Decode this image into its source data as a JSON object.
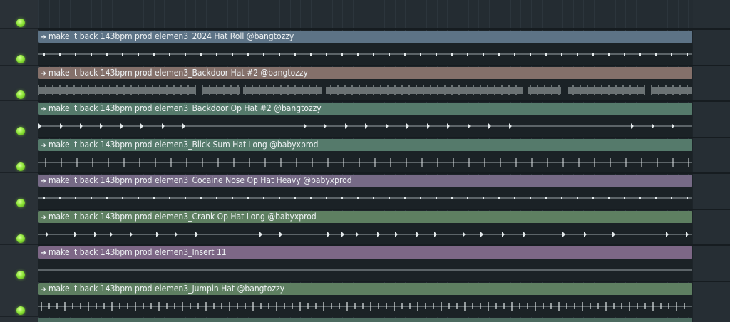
{
  "tracks": [
    {
      "label": "make it back 143bpm prod elemen3_2024 Hat Roll @bangtozzy",
      "color": "#5d7386",
      "wave": "sparse-diamonds"
    },
    {
      "label": "make it back 143bpm prod elemen3_Backdoor Hat #2 @bangtozzy",
      "color": "#84706a",
      "wave": "dense"
    },
    {
      "label": "make it back 143bpm prod elemen3_Backdoor Op Hat #2 @bangtozzy",
      "color": "#557a6b",
      "wave": "arrows-a"
    },
    {
      "label": "make it back 143bpm prod elemen3_Blick Sum Hat Long @babyxprod",
      "color": "#557a6b",
      "wave": "ticks"
    },
    {
      "label": "make it back 143bpm prod elemen3_Cocaine Nose Op Hat Heavy @babyxprod",
      "color": "#766a86",
      "wave": "sparse-diamonds"
    },
    {
      "label": "make it back 143bpm prod elemen3_Crank Op Hat Long @babyxprod",
      "color": "#5e7f61",
      "wave": "arrows-b"
    },
    {
      "label": "make it back 143bpm prod elemen3_Insert 11",
      "color": "#7d6786",
      "wave": "flat"
    },
    {
      "label": "make it back 143bpm prod elemen3_Jumpin Hat @bangtozzy",
      "color": "#5e7f61",
      "wave": "double-ticks"
    }
  ],
  "icons": {
    "clip_arrow": "clip-arrow-icon",
    "led": "track-enable-led-icon"
  }
}
